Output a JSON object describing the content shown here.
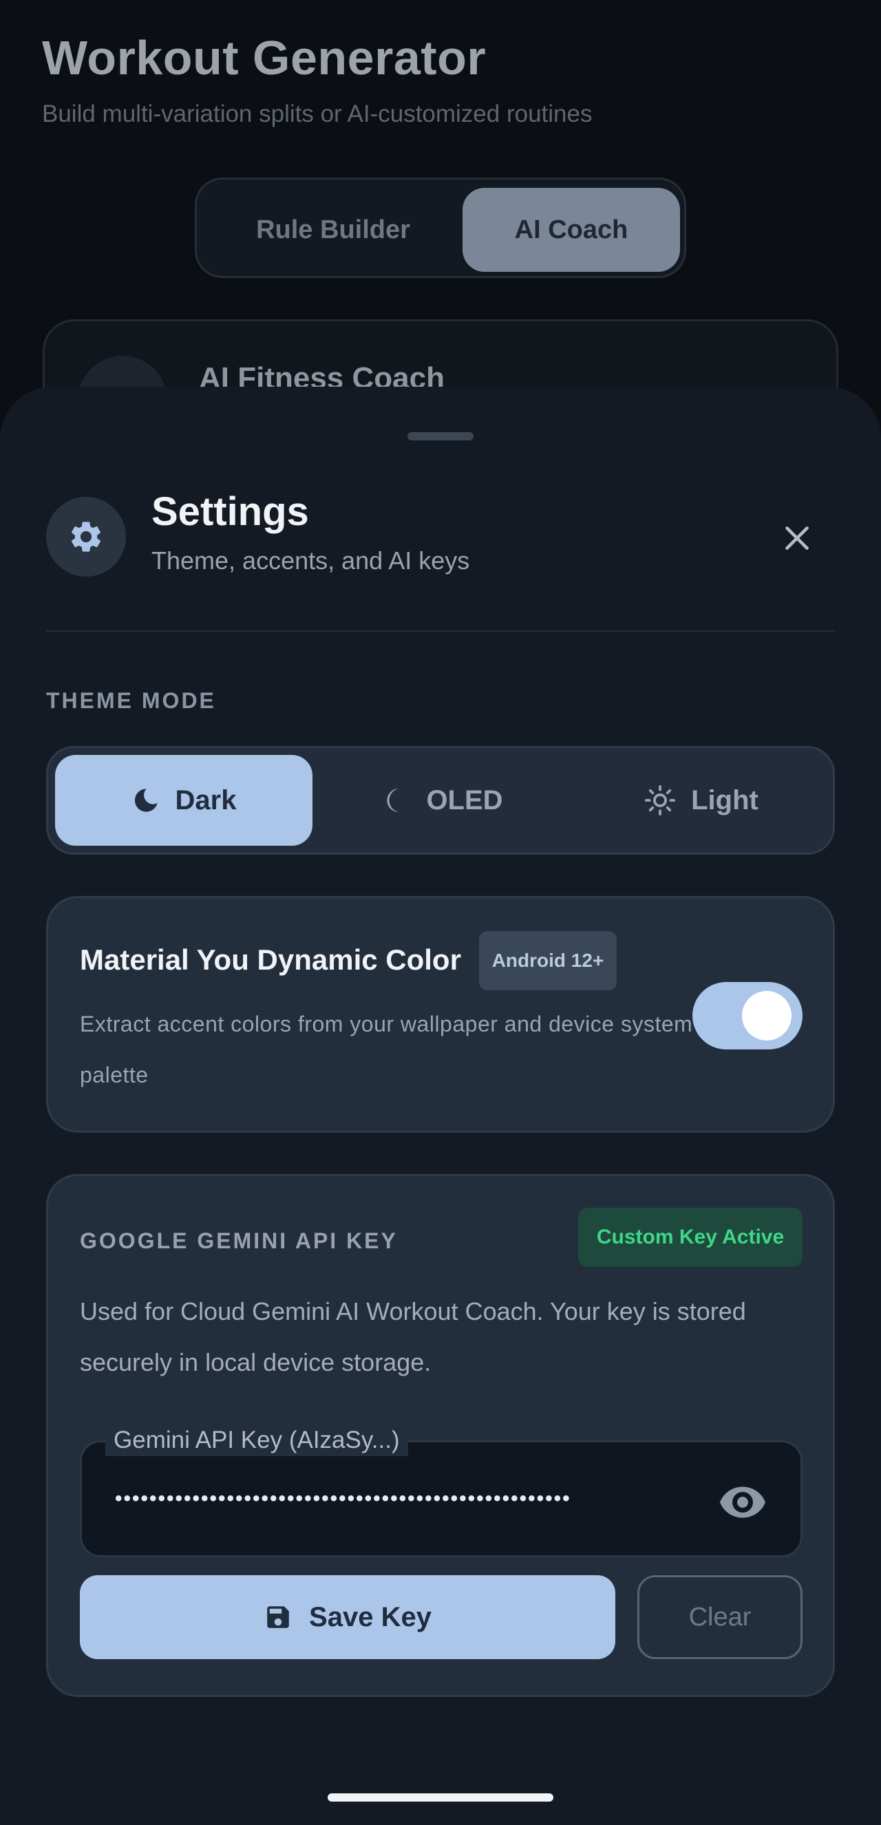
{
  "background": {
    "title": "Workout Generator",
    "subtitle": "Build multi-variation splits or AI-customized routines",
    "mode_tabs": [
      "Rule Builder",
      "AI Coach"
    ],
    "selected_tab": "AI Coach",
    "card_title": "AI Fitness Coach"
  },
  "sheet": {
    "title": "Settings",
    "subtitle": "Theme, accents, and AI keys",
    "header_icon": "gear-icon",
    "close_icon": "close-icon",
    "theme_mode": {
      "label": "THEME MODE",
      "options": [
        {
          "label": "Dark",
          "icon": "moon-icon"
        },
        {
          "label": "OLED",
          "icon": "half-moon-icon"
        },
        {
          "label": "Light",
          "icon": "sun-icon"
        }
      ],
      "selected": "Dark"
    },
    "material_you": {
      "title": "Material You Dynamic Color",
      "badge": "Android 12+",
      "description": "Extract accent colors from your wallpaper and device system palette",
      "enabled": true
    },
    "gemini": {
      "label": "GOOGLE GEMINI API KEY",
      "status_badge": "Custom Key Active",
      "description": "Used for Cloud Gemini AI Workout Coach. Your key is stored securely in local device storage.",
      "field_label": "Gemini API Key (AIzaSy...)",
      "field_value": "•••••••••••••••••••••••••••••••••••••••••••••••••••••",
      "save_label": "Save Key",
      "clear_label": "Clear"
    }
  },
  "colors": {
    "accent": "#abc6e8",
    "sheet_bg": "#141a23",
    "card_bg": "#232e3d",
    "success": "#3fd68a"
  }
}
